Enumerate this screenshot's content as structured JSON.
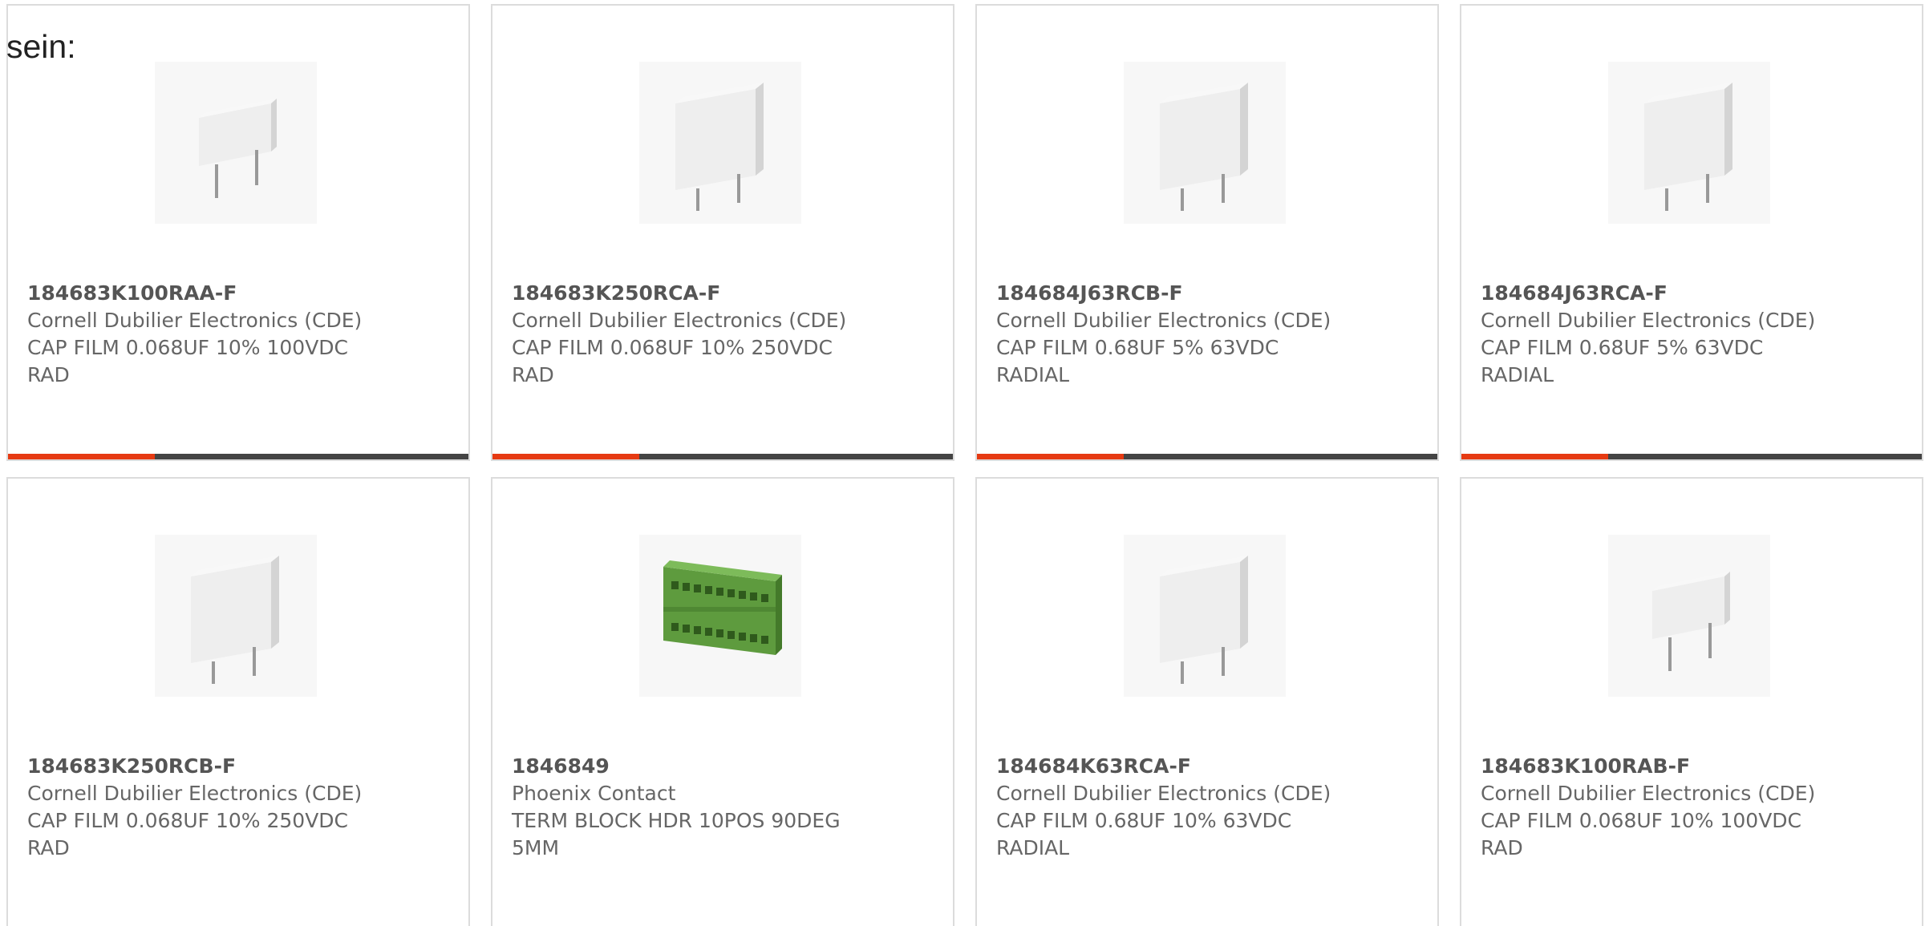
{
  "intro_text": "sein:",
  "colors": {
    "card_border": "#dcdcdc",
    "bar_dark": "#444444",
    "bar_accent": "#e63a12",
    "capacitor_body": "#e6e6e6",
    "terminal_block": "#5e9b3e"
  },
  "products": [
    {
      "part_number": "184683K100RAA-F",
      "manufacturer": "Cornell Dubilier Electronics (CDE)",
      "description": "CAP FILM 0.068UF 10% 100VDC RAD",
      "image_icon": "capacitor-small-icon",
      "progress": 0.32
    },
    {
      "part_number": "184683K250RCA-F",
      "manufacturer": "Cornell Dubilier Electronics (CDE)",
      "description": "CAP FILM 0.068UF 10% 250VDC RAD",
      "image_icon": "capacitor-icon",
      "progress": 0.32
    },
    {
      "part_number": "184684J63RCB-F",
      "manufacturer": "Cornell Dubilier Electronics (CDE)",
      "description": "CAP FILM 0.68UF 5% 63VDC RADIAL",
      "image_icon": "capacitor-icon",
      "progress": 0.32
    },
    {
      "part_number": "184684J63RCA-F",
      "manufacturer": "Cornell Dubilier Electronics (CDE)",
      "description": "CAP FILM 0.68UF 5% 63VDC RADIAL",
      "image_icon": "capacitor-icon",
      "progress": 0.32
    },
    {
      "part_number": "184683K250RCB-F",
      "manufacturer": "Cornell Dubilier Electronics (CDE)",
      "description": "CAP FILM 0.068UF 10% 250VDC RAD",
      "image_icon": "capacitor-icon"
    },
    {
      "part_number": "1846849",
      "manufacturer": "Phoenix Contact",
      "description": "TERM BLOCK HDR 10POS 90DEG 5MM",
      "image_icon": "terminal-block-icon"
    },
    {
      "part_number": "184684K63RCA-F",
      "manufacturer": "Cornell Dubilier Electronics (CDE)",
      "description": "CAP FILM 0.68UF 10% 63VDC RADIAL",
      "image_icon": "capacitor-icon"
    },
    {
      "part_number": "184683K100RAB-F",
      "manufacturer": "Cornell Dubilier Electronics (CDE)",
      "description": "CAP FILM 0.068UF 10% 100VDC RAD",
      "image_icon": "capacitor-small-icon"
    }
  ]
}
